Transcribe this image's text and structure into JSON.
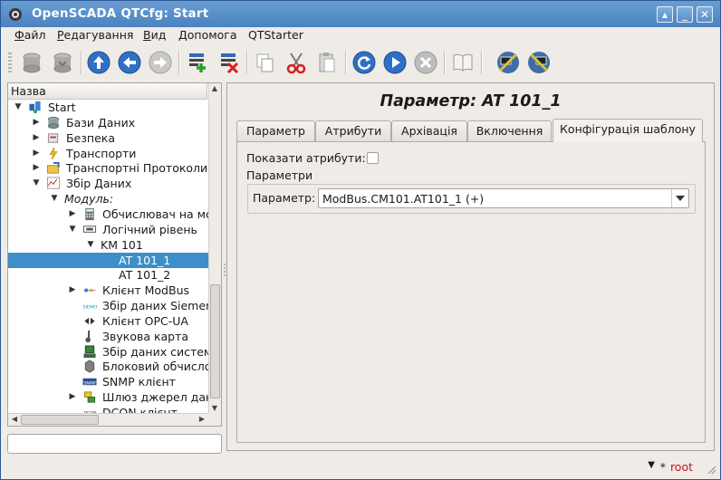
{
  "window": {
    "title": "OpenSCADA QTCfg: Start",
    "controls": [
      "▴",
      "_",
      "□",
      "✕"
    ]
  },
  "menu": [
    "Файл",
    "Редагування",
    "Вид",
    "Допомога",
    "QTStarter"
  ],
  "menu_underline": [
    "Ф",
    "Р",
    "В",
    "Д",
    ""
  ],
  "toolbar": {
    "icons": [
      "db-load-icon",
      "db-save-icon",
      "up-icon",
      "back-icon",
      "forward-icon",
      "add-item-icon",
      "delete-item-icon",
      "copy-icon",
      "cut-icon",
      "paste-icon",
      "refresh-icon",
      "start-icon",
      "stop-icon",
      "manual-icon",
      "station-sync-icon",
      "station-config-icon"
    ]
  },
  "tree": {
    "header": "Назва",
    "items": [
      {
        "label": "Start",
        "level": 0,
        "expander": "down",
        "icon": "start-icon",
        "italic": false,
        "selected": false
      },
      {
        "label": "Бази Даних",
        "level": 1,
        "expander": "right",
        "icon": "database-icon",
        "italic": false,
        "selected": false
      },
      {
        "label": "Безпека",
        "level": 1,
        "expander": "right",
        "icon": "security-icon",
        "italic": false,
        "selected": false
      },
      {
        "label": "Транспорти",
        "level": 1,
        "expander": "right",
        "icon": "transport-icon",
        "italic": false,
        "selected": false
      },
      {
        "label": "Транспортні Протоколи",
        "level": 1,
        "expander": "right",
        "icon": "protocol-icon",
        "italic": false,
        "selected": false
      },
      {
        "label": "Збір Даних",
        "level": 1,
        "expander": "down",
        "icon": "daq-icon",
        "italic": false,
        "selected": false
      },
      {
        "label": "Модуль:",
        "level": 2,
        "expander": "down",
        "icon": "",
        "italic": true,
        "selected": false
      },
      {
        "label": "Обчислювач на мо",
        "level": 3,
        "expander": "right",
        "icon": "calculator-icon",
        "italic": false,
        "selected": false
      },
      {
        "label": "Логічний рівень",
        "level": 3,
        "expander": "down",
        "icon": "logic-level-icon",
        "italic": false,
        "selected": false
      },
      {
        "label": "KM 101",
        "level": 4,
        "expander": "down",
        "icon": "",
        "italic": false,
        "selected": false
      },
      {
        "label": "AT 101_1",
        "level": 5,
        "expander": "",
        "icon": "",
        "italic": false,
        "selected": true
      },
      {
        "label": "AT 101_2",
        "level": 5,
        "expander": "",
        "icon": "",
        "italic": false,
        "selected": false
      },
      {
        "label": "Клієнт ModBus",
        "level": 3,
        "expander": "right",
        "icon": "modbus-icon",
        "italic": false,
        "selected": false
      },
      {
        "label": "Збір даних Siemen",
        "level": 3,
        "expander": "",
        "icon": "siemens-icon",
        "italic": false,
        "selected": false
      },
      {
        "label": "Клієнт OPC-UA",
        "level": 3,
        "expander": "",
        "icon": "opcua-icon",
        "italic": false,
        "selected": false
      },
      {
        "label": "Звукова карта",
        "level": 3,
        "expander": "",
        "icon": "soundcard-icon",
        "italic": false,
        "selected": false
      },
      {
        "label": "Збір даних систем",
        "level": 3,
        "expander": "",
        "icon": "system-icon",
        "italic": false,
        "selected": false
      },
      {
        "label": "Блоковий обчисло",
        "level": 3,
        "expander": "",
        "icon": "block-calc-icon",
        "italic": false,
        "selected": false
      },
      {
        "label": "SNMP клієнт",
        "level": 3,
        "expander": "",
        "icon": "snmp-icon",
        "italic": false,
        "selected": false
      },
      {
        "label": "Шлюз джерел дан",
        "level": 3,
        "expander": "right",
        "icon": "gateway-icon",
        "italic": false,
        "selected": false
      },
      {
        "label": "DCON клієнт",
        "level": 3,
        "expander": "",
        "icon": "dcon-icon",
        "italic": false,
        "selected": false
      }
    ]
  },
  "command_input": {
    "value": ""
  },
  "main": {
    "heading": "Параметр: AT 101_1",
    "tabs": [
      "Параметр",
      "Атрибути",
      "Архівація",
      "Включення",
      "Конфігурація шаблону"
    ],
    "active_tab": 4,
    "show_attributes_label": "Показати атрибути:",
    "show_attributes_checked": false,
    "params_label": "Параметри",
    "param_field_label": "Параметр:",
    "param_value": "ModBus.CM101.AT101_1 (+)"
  },
  "status": {
    "arrow": "▼",
    "star": "*",
    "user": "root"
  },
  "colors": {
    "title_bar": "#4a82c0",
    "selection": "#3d8ec9",
    "user": "#c4141f"
  }
}
